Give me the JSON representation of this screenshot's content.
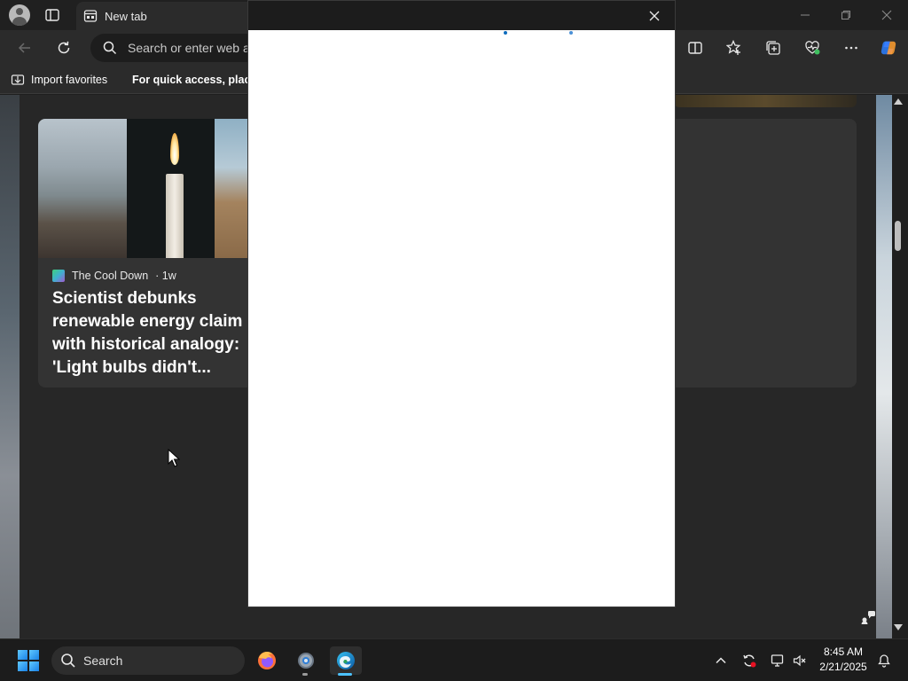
{
  "browser": {
    "tab_title": "New tab",
    "address_placeholder": "Search or enter web address",
    "favorites": {
      "import_label": "Import favorites",
      "hint_text": "For quick access, place your favorites here on the favorites bar."
    }
  },
  "feed": {
    "card": {
      "source": "The Cool Down",
      "age": "· 1w",
      "headline": "Scientist debunks renewable energy claim with historical analogy: 'Light bulbs didn't..."
    }
  },
  "taskbar": {
    "search_label": "Search",
    "time": "8:45 AM",
    "date": "2/21/2025"
  },
  "colors": {
    "accent": "#0f6cbd",
    "edge_indicator": "#4cc2ff"
  }
}
